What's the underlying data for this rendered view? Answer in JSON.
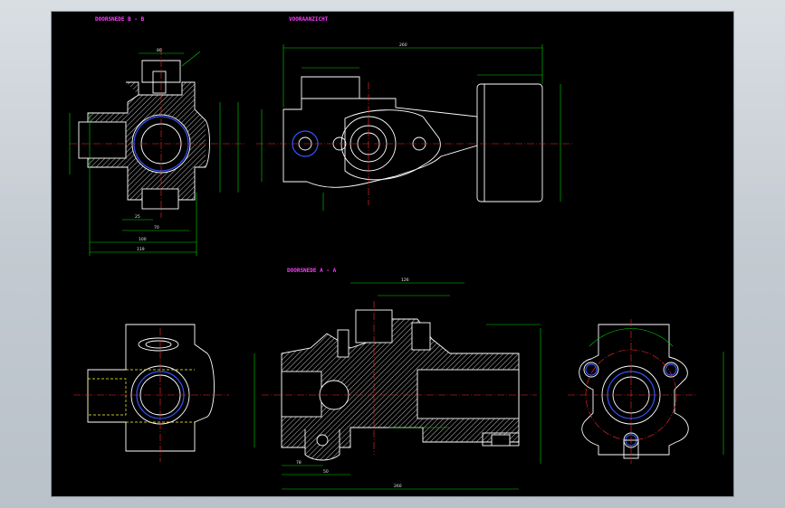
{
  "views": {
    "section_bb": "DOORSNEDE B - B",
    "front": "VOORAANZICHT",
    "section_aa": "DOORSNEDE A - A"
  },
  "dimensions": {
    "bb_overall": "119",
    "bb_100": "100",
    "bb_70": "70",
    "bb_25": "25",
    "bb_80": "80",
    "front_overall": "260",
    "aa_overall": "260",
    "aa_126": "126",
    "aa_78": "78",
    "aa_50": "50"
  },
  "colors": {
    "background": "#000000",
    "outline": "#ffffff",
    "dimension": "#00d400",
    "centerline": "#ff2a2a",
    "hidden": "#ffff33",
    "bore": "#3355ff",
    "title": "#ff3cff"
  }
}
